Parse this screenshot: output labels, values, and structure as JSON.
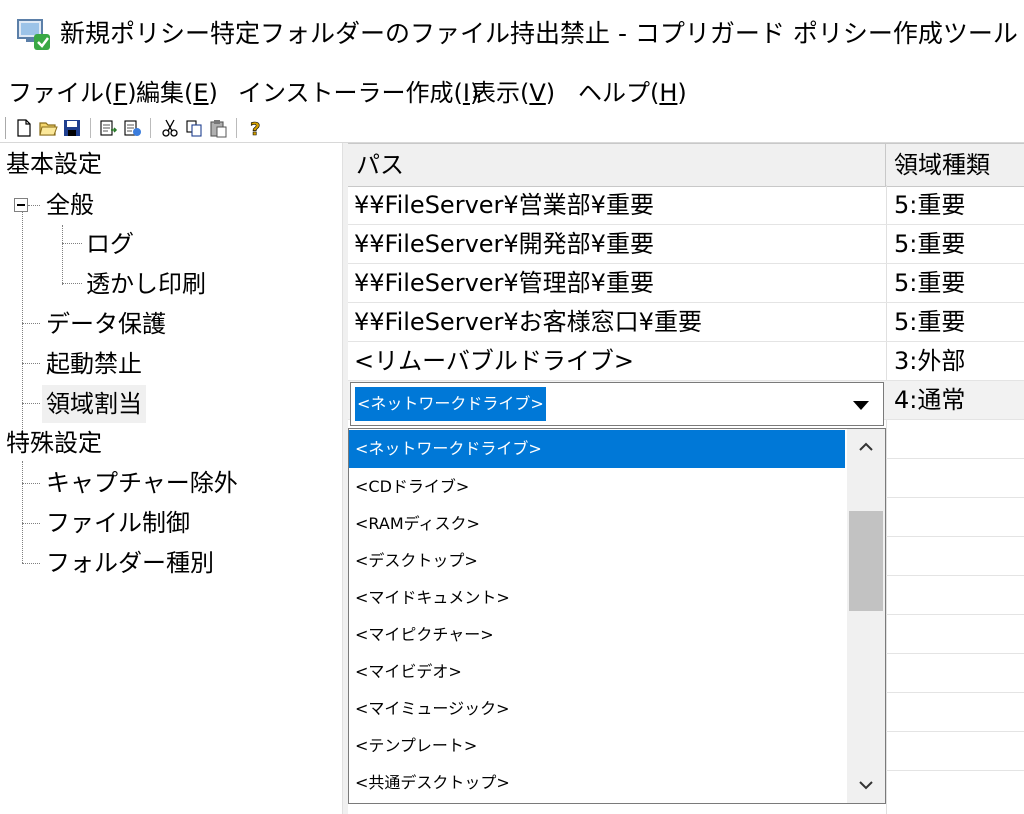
{
  "window": {
    "title": "新規ポリシー特定フォルダーのファイル持出禁止 - コプリガード ポリシー作成ツール"
  },
  "menu": [
    {
      "label": "ファイル(",
      "key": "F",
      "end": ")"
    },
    {
      "label": "編集(",
      "key": "E",
      "end": ")"
    },
    {
      "label": "インストーラー作成(",
      "key": "I",
      "end": ")"
    },
    {
      "label": "表示(",
      "key": "V",
      "end": ")"
    },
    {
      "label": "ヘルプ(",
      "key": "H",
      "end": ")"
    }
  ],
  "toolbar": {
    "icons": [
      "new-file-icon",
      "open-folder-icon",
      "save-icon",
      "import-icon",
      "export-icon",
      "cut-icon",
      "copy-icon",
      "paste-icon",
      "help-icon"
    ]
  },
  "tree": {
    "basic": "基本設定",
    "general": "全般",
    "log": "ログ",
    "watermark": "透かし印刷",
    "data_protection": "データ保護",
    "launch_block": "起動禁止",
    "area_assign": "領域割当",
    "special": "特殊設定",
    "capture_exclude": "キャプチャー除外",
    "file_control": "ファイル制御",
    "folder_type": "フォルダー種別"
  },
  "grid": {
    "headers": {
      "path": "パス",
      "type": "領域種類"
    },
    "rows": [
      {
        "path": "¥¥FileServer¥営業部¥重要",
        "type": "5:重要"
      },
      {
        "path": "¥¥FileServer¥開発部¥重要",
        "type": "5:重要"
      },
      {
        "path": "¥¥FileServer¥管理部¥重要",
        "type": "5:重要"
      },
      {
        "path": "¥¥FileServer¥お客様窓口¥重要",
        "type": "5:重要"
      },
      {
        "path": "<リムーバブルドライブ>",
        "type": "3:外部"
      }
    ],
    "edit_row": {
      "path": "<ネットワークドライブ>",
      "type": "4:通常"
    }
  },
  "dropdown": {
    "options": [
      "<ネットワークドライブ>",
      "<CDドライブ>",
      "<RAMディスク>",
      "<デスクトップ>",
      "<マイドキュメント>",
      "<マイピクチャー>",
      "<マイビデオ>",
      "<マイミュージック>",
      "<テンプレート>",
      "<共通デスクトップ>"
    ],
    "selected": "<ネットワークドライブ>"
  },
  "colors": {
    "selection": "#0078d7",
    "header_bg": "#f0f0f0"
  }
}
